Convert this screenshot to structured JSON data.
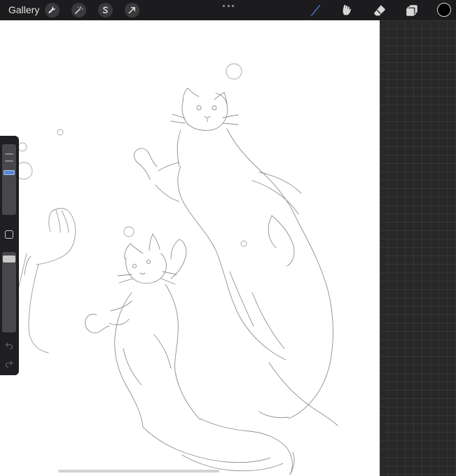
{
  "topbar": {
    "gallery_label": "Gallery",
    "left_tools": [
      "wrench-icon",
      "magic-wand-icon",
      "selection-icon",
      "transform-arrow-icon"
    ],
    "right_tools": [
      "brush-icon",
      "smudge-icon",
      "eraser-icon",
      "layers-icon"
    ],
    "active_tool": "brush",
    "active_color": "#000000"
  },
  "sidebar": {
    "brush_size_level": 0.3,
    "opacity_level": 0.95
  },
  "colors": {
    "accent": "#4a7fd8",
    "topbar_bg": "#1c1c1e",
    "canvas_bg": "#ffffff",
    "grid_bg": "#282828"
  }
}
